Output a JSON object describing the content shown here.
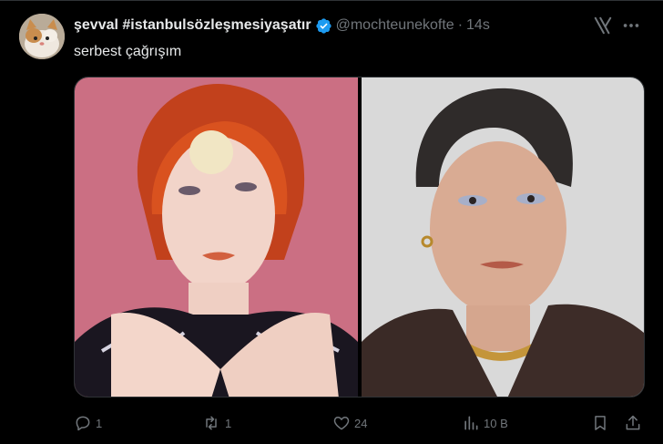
{
  "tweet": {
    "display_name": "şevval #istanbulsözleşmesiyaşatır",
    "handle": "@mochteunekofte",
    "separator": "·",
    "time": "14s",
    "text": "serbest çağrışım"
  },
  "actions": {
    "reply_count": "1",
    "retweet_count": "1",
    "like_count": "24",
    "views_count": "10 B"
  },
  "colors": {
    "background": "#000000",
    "primary_text": "#e7e9ea",
    "secondary_text": "#71767b",
    "verified": "#1d9bf0",
    "border": "#2f3336"
  },
  "icons": {
    "verified": "verified-badge-icon",
    "grok": "grok-icon",
    "more": "more-icon",
    "reply": "reply-icon",
    "retweet": "retweet-icon",
    "like": "heart-icon",
    "views": "views-icon",
    "bookmark": "bookmark-icon",
    "share": "share-icon"
  }
}
